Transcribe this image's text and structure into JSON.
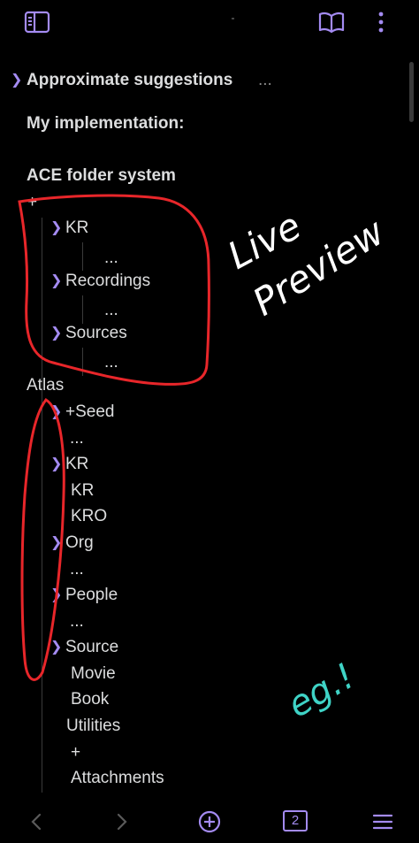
{
  "colors": {
    "accent": "#a48bf2",
    "background": "#000000",
    "text": "#dcddde",
    "annotation_red": "#e8262a",
    "annotation_white": "#ffffff",
    "annotation_teal": "#3fd3c6"
  },
  "toolbar": {
    "left_icon": "sidebar-toggle-icon",
    "reading_icon": "book-open-icon",
    "more_icon": "more-vertical-icon"
  },
  "note": {
    "approx_heading": "Approximate suggestions",
    "approx_ellipsis": "...",
    "impl_heading": "My implementation:",
    "ace_heading": "ACE folder system",
    "plus_root": "+",
    "ace_kr": "KR",
    "ace_kr_dots": "...",
    "ace_recordings": "Recordings",
    "ace_recordings_dots": "...",
    "ace_sources": "Sources",
    "ace_sources_dots": "...",
    "atlas": "Atlas",
    "atlas_seed": "+Seed",
    "atlas_seed_dots": "...",
    "atlas_kr": "KR",
    "atlas_kr_child1": "KR",
    "atlas_kr_child2": "KRO",
    "atlas_org": "Org",
    "atlas_org_dots": "...",
    "atlas_people": "People",
    "atlas_people_dots": "...",
    "atlas_source": "Source",
    "atlas_source_movie": "Movie",
    "atlas_source_book": "Book",
    "utilities": "Utilities",
    "utilities_plus": "+",
    "utilities_attachments": "Attachments"
  },
  "annotations": {
    "live_preview_line1": "Live",
    "live_preview_line2": "Preview",
    "eg": "eg.!"
  },
  "bottom_nav": {
    "back_icon": "chevron-left-icon",
    "forward_icon": "chevron-right-icon",
    "new_icon": "plus-circle-icon",
    "tab_count": "2",
    "menu_icon": "hamburger-menu-icon"
  }
}
